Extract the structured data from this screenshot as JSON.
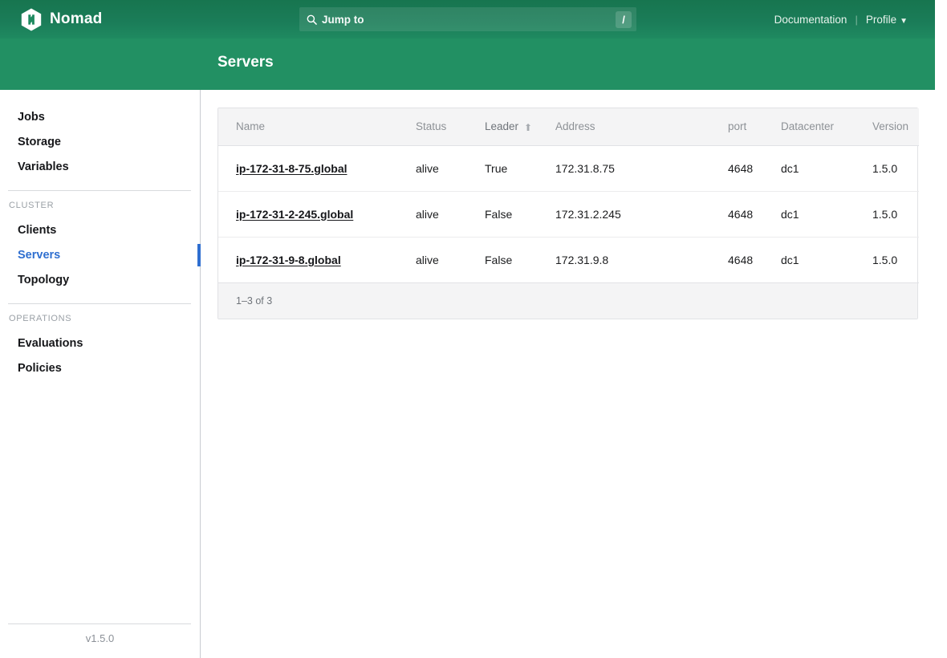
{
  "topnav": {
    "brand": "Nomad",
    "logo_icon": "nomad-hexagon-logo",
    "search_icon": "search-icon",
    "search_placeholder": "Jump to",
    "search_value": "",
    "slash_key": "/",
    "documentation_label": "Documentation",
    "separator": "|",
    "profile_label": "Profile",
    "profile_caret": "▼",
    "bg_color": "#1a7a55"
  },
  "subheader": {
    "title": "Servers",
    "bg_color": "#229063"
  },
  "sidebar": {
    "primary_items": [
      {
        "label": "Jobs",
        "active": false
      },
      {
        "label": "Storage",
        "active": false
      },
      {
        "label": "Variables",
        "active": false
      }
    ],
    "sections": [
      {
        "title": "CLUSTER",
        "items": [
          {
            "label": "Clients",
            "active": false
          },
          {
            "label": "Servers",
            "active": true
          },
          {
            "label": "Topology",
            "active": false
          }
        ]
      },
      {
        "title": "OPERATIONS",
        "items": [
          {
            "label": "Evaluations",
            "active": false
          },
          {
            "label": "Policies",
            "active": false
          }
        ]
      }
    ],
    "version": "v1.5.0",
    "active_color": "#2f6fd0"
  },
  "table": {
    "columns": [
      {
        "label": "Name",
        "sorted": false,
        "sort_icon": ""
      },
      {
        "label": "Status",
        "sorted": false,
        "sort_icon": ""
      },
      {
        "label": "Leader",
        "sorted": true,
        "sort_icon": "⬆"
      },
      {
        "label": "Address",
        "sorted": false,
        "sort_icon": ""
      },
      {
        "label": "port",
        "sorted": false,
        "sort_icon": ""
      },
      {
        "label": "Datacenter",
        "sorted": false,
        "sort_icon": ""
      },
      {
        "label": "Version",
        "sorted": false,
        "sort_icon": ""
      }
    ],
    "rows": [
      {
        "name": "ip-172-31-8-75.global",
        "status": "alive",
        "leader": "True",
        "address": "172.31.8.75",
        "port": "4648",
        "datacenter": "dc1",
        "version": "1.5.0"
      },
      {
        "name": "ip-172-31-2-245.global",
        "status": "alive",
        "leader": "False",
        "address": "172.31.2.245",
        "port": "4648",
        "datacenter": "dc1",
        "version": "1.5.0"
      },
      {
        "name": "ip-172-31-9-8.global",
        "status": "alive",
        "leader": "False",
        "address": "172.31.9.8",
        "port": "4648",
        "datacenter": "dc1",
        "version": "1.5.0"
      }
    ],
    "footer_text": "1–3 of 3"
  }
}
